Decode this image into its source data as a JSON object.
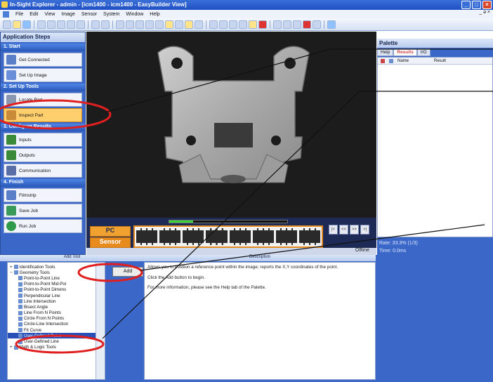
{
  "window": {
    "title": "In-Sight Explorer - admin - [icm1400 - icm1400 - EasyBuilder View]"
  },
  "menu": [
    "File",
    "Edit",
    "View",
    "Image",
    "Sensor",
    "System",
    "Window",
    "Help"
  ],
  "mdi_controls": "_ ə ×",
  "steps": {
    "title": "Application Steps",
    "sections": [
      {
        "heading": "1. Start",
        "items": [
          "Get Connected",
          "Set Up Image"
        ]
      },
      {
        "heading": "2. Set Up Tools",
        "items": [
          "Locate Part",
          "Inspect Part"
        ]
      },
      {
        "heading": "3. Configure Results",
        "items": [
          "Inputs",
          "Outputs",
          "Communication"
        ]
      },
      {
        "heading": "4. Finish",
        "items": [
          "Filmstrip",
          "Save Job",
          "Run Job"
        ]
      }
    ]
  },
  "viewer": {
    "mode_pc": "PC",
    "mode_sensor": "Sensor",
    "status": "Offline",
    "nav": [
      "|<",
      "<<",
      ">>",
      ">|"
    ],
    "progress": 0.2
  },
  "palette": {
    "title": "Palette",
    "tabs": [
      "Help",
      "Results",
      "I/O"
    ],
    "columns": [
      "Name",
      "Result"
    ],
    "rate": "Rate: 33.3% (1/3)",
    "time": "Time: 0.0ms"
  },
  "add_tool": {
    "title": "Add Tool",
    "add_label": "Add",
    "tree": [
      {
        "label": "Identification Tools",
        "level": 0,
        "expander": "+"
      },
      {
        "label": "Geometry Tools",
        "level": 0,
        "expander": "−"
      },
      {
        "label": "Point-to-Point Line",
        "level": 1
      },
      {
        "label": "Point-to-Point Mid-Poi",
        "level": 1
      },
      {
        "label": "Point-to-Point Dimens",
        "level": 1
      },
      {
        "label": "Perpendicular Line",
        "level": 1
      },
      {
        "label": "Line Intersection",
        "level": 1
      },
      {
        "label": "Bisect Angle",
        "level": 1
      },
      {
        "label": "Line From N Points",
        "level": 1
      },
      {
        "label": "Circle From N Points",
        "level": 1
      },
      {
        "label": "Circle-Line Intersection",
        "level": 1
      },
      {
        "label": "Fit Curve",
        "level": 1
      },
      {
        "label": "User-Defined Point",
        "level": 1,
        "selected": true
      },
      {
        "label": "User-Defined Line",
        "level": 1
      },
      {
        "label": "Math & Logic Tools",
        "level": 0,
        "expander": "+"
      }
    ]
  },
  "description": {
    "title": "Description",
    "paragraphs": [
      "Allows you to position a reference point within the image; reports the X,Y coordinates of the point.",
      "Click the Add button to begin.",
      "For more information, please see the Help tab of the Palette."
    ]
  },
  "colors": {
    "accent": "#3b68c8",
    "highlight": "#e02020",
    "active_step": "#ffcf6e"
  }
}
